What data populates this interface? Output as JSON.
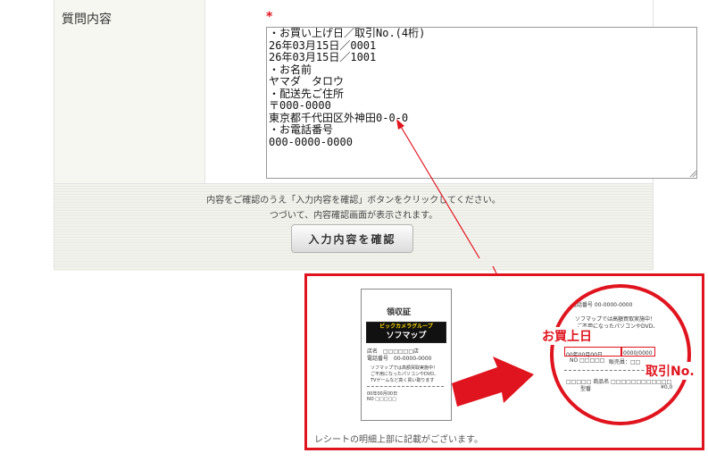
{
  "form": {
    "label": "質問内容",
    "required_mark": "*",
    "textarea_value": "・お買い上げ日／取引No.(4桁)\n26年03月15日／0001\n26年03月15日／1001\n・お名前\nヤマダ　タロウ\n・配送先ご住所\n〒000-0000\n東京都千代田区外神田0-0-0\n・お電話番号\n000-0000-0000",
    "notice_line1": "内容をご確認のうえ「入力内容を確認」ボタンをクリックしてください。",
    "notice_line2": "つづいて、内容確認画面が表示されます。",
    "confirm_button": "入力内容を確認"
  },
  "callout": {
    "receipt_title": "領収証",
    "brand_top": "ビックカメラグループ",
    "brand_name": "ソフマップ",
    "store_line1": "店名　□□□□□□店",
    "store_line2": "電話番号　00-0000-0000",
    "store_line3": "ソフマップでは高額買取実施中！",
    "store_line4": "ご不用になったパソコンやDVD、",
    "store_line5": "TVゲームなど高く買い取ります",
    "zoom_phone": "電話番号 00-0000-0000",
    "zoom_promo1": "ソフマップでは高額買取実施中！",
    "zoom_promo2": "ご不用になったパソコンやDVD、",
    "zoom_date": "00年00月00日",
    "zoom_seller": "販売員：□□",
    "zoom_no": "NO □□□□□",
    "zoom_slash": "0000/0000",
    "zoom_product": "□□□□□ 商品名 □□□□□□□□□□□□",
    "zoom_model": "型番",
    "zoom_price": "¥0,0",
    "purchase_date_label": "お買上日",
    "transaction_no_label": "取引No.",
    "caption": "レシートの明細上部に記載がございます。"
  },
  "colors": {
    "accent_red": "#e0141e",
    "required_red": "#e0141e"
  }
}
